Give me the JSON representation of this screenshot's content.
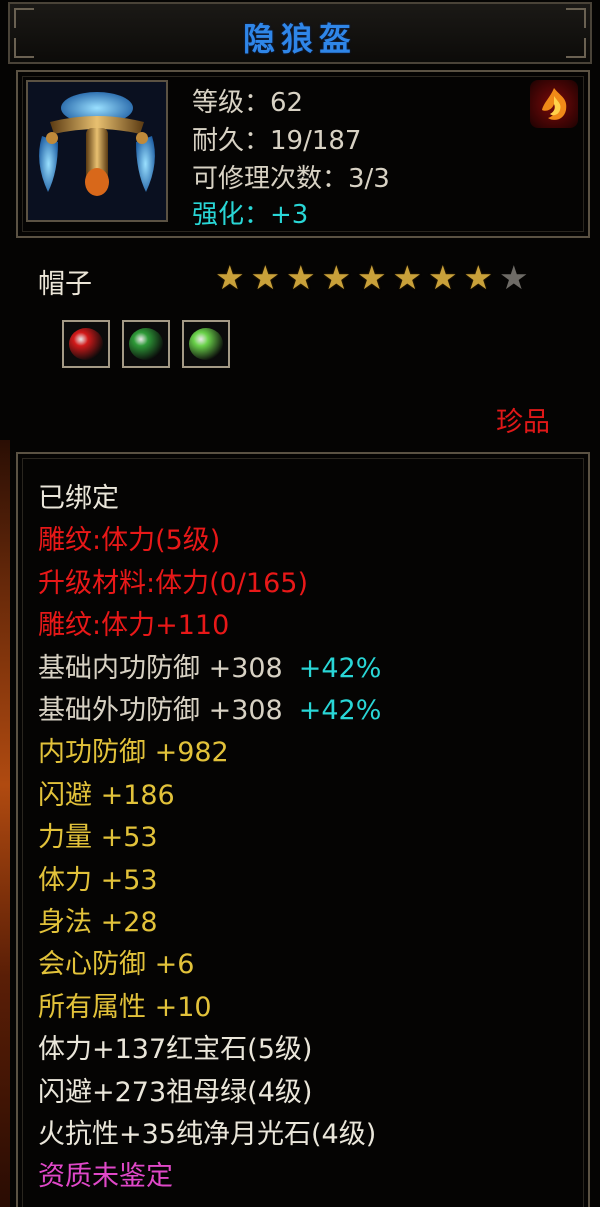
{
  "item": {
    "name": "隐狼盔",
    "level": "等级：62",
    "durability": "耐久：19/187",
    "repair_count": "可修理次数：3/3",
    "enhance": "强化：+3",
    "slot": "帽子",
    "rarity": "珍品",
    "icon": "helmet-icon",
    "element_icon": "fire-element-icon"
  },
  "stars": {
    "filled": 8,
    "total": 9
  },
  "gems": [
    {
      "icon": "ruby-gem-icon",
      "color": "#d21a1a"
    },
    {
      "icon": "emerald-gem-icon",
      "color": "#2e9a38"
    },
    {
      "icon": "jade-gem-icon",
      "color": "#6ad24a"
    }
  ],
  "properties": [
    {
      "text": "已绑定",
      "color": "white"
    },
    {
      "text": "雕纹:体力(5级)",
      "color": "red"
    },
    {
      "text": "升级材料:体力(0/165)",
      "color": "red"
    },
    {
      "text": "雕纹:体力+110",
      "color": "red"
    },
    {
      "text": "基础内功防御 +308",
      "extra": "+42%",
      "color": "gray"
    },
    {
      "text": "基础外功防御 +308",
      "extra": "+42%",
      "color": "gray"
    },
    {
      "text": "内功防御 +982",
      "color": "gold"
    },
    {
      "text": "闪避 +186",
      "color": "gold"
    },
    {
      "text": "力量 +53",
      "color": "gold"
    },
    {
      "text": "体力 +53",
      "color": "gold"
    },
    {
      "text": "身法 +28",
      "color": "gold"
    },
    {
      "text": "会心防御 +6",
      "color": "gold"
    },
    {
      "text": "所有属性 +10",
      "color": "gold"
    },
    {
      "text": "体力+137红宝石(5级)",
      "color": "white"
    },
    {
      "text": "闪避+273祖母绿(4级)",
      "color": "white"
    },
    {
      "text": "火抗性+35纯净月光石(4级)",
      "color": "white"
    },
    {
      "text": "资质未鉴定",
      "color": "pink"
    }
  ],
  "colors": {
    "title": "#2f86e8",
    "enhance": "#29d6d6",
    "rarity": "#e01818"
  }
}
